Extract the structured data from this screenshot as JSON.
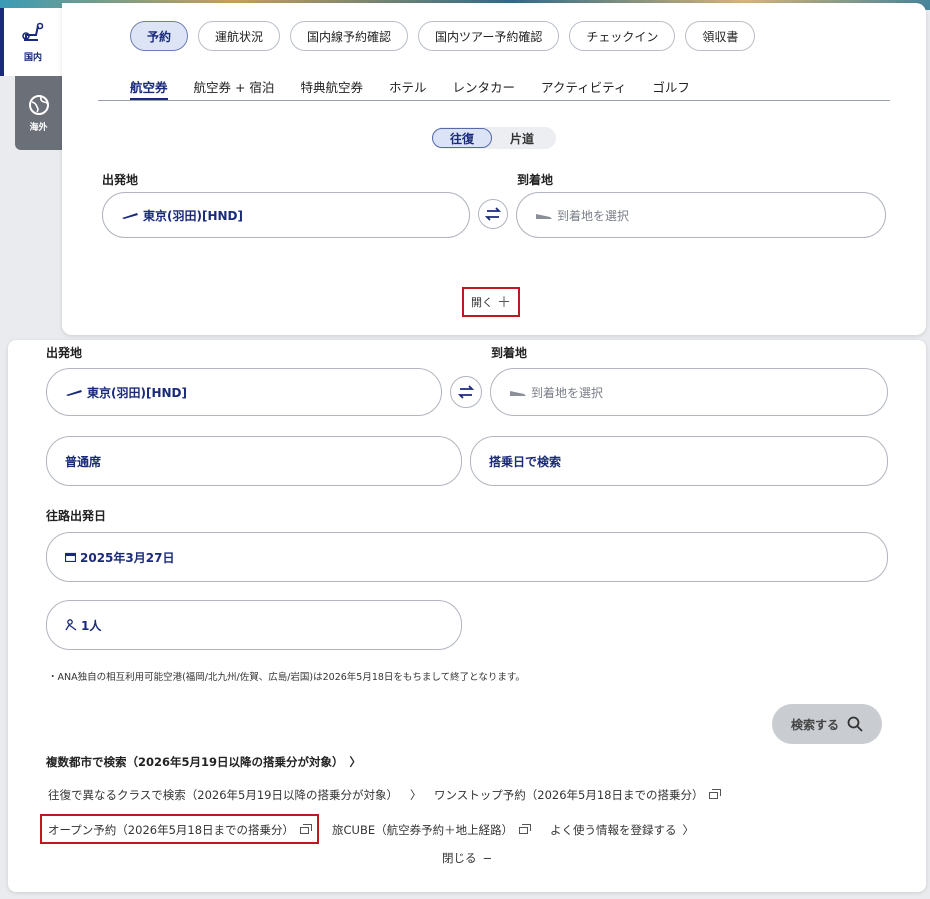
{
  "side_tabs": {
    "domestic_label": "国内",
    "international_label": "海外"
  },
  "top_nav": [
    "予約",
    "運航状況",
    "国内線予約確認",
    "国内ツアー予約確認",
    "チェックイン",
    "領収書"
  ],
  "sub_tabs": [
    "航空券",
    "航空券 + 宿泊",
    "特典航空券",
    "ホテル",
    "レンタカー",
    "アクティビティ",
    "ゴルフ"
  ],
  "trip_type": {
    "round_trip": "往復",
    "one_way": "片道"
  },
  "top_form": {
    "departure_label": "出発地",
    "departure_value": "東京(羽田)[HND]",
    "arrival_label": "到着地",
    "arrival_placeholder": "到着地を選択",
    "open_label": "開く"
  },
  "expanded_form": {
    "departure_label": "出発地",
    "departure_value": "東京(羽田)[HND]",
    "arrival_label": "到着地",
    "arrival_placeholder": "到着地を選択",
    "seat_class": "普通席",
    "search_by": "搭乗日で検索",
    "date_label": "往路出発日",
    "date_value": "2025年3月27日",
    "passengers": "1人",
    "note": "・ANA独自の相互利用可能空港(福岡/北九州/佐賀、広島/岩国)は2026年5月18日をもちまして終了となります。",
    "search_button": "検索する"
  },
  "links": {
    "multi_city": "複数都市で検索（2026年5月19日以降の搭乗分が対象）",
    "diff_class": "往復で異なるクラスで検索（2026年5月19日以降の搭乗分が対象）",
    "one_stop": "ワンストップ予約（2026年5月18日までの搭乗分）",
    "open_booking": "オープン予約（2026年5月18日までの搭乗分）",
    "tabi_cube": "旅CUBE（航空券予約＋地上経路）",
    "register_info": "よく使う情報を登録する",
    "close": "閉じる"
  },
  "colors": {
    "brand": "#1a2a7a",
    "highlight": "#c0181f"
  }
}
